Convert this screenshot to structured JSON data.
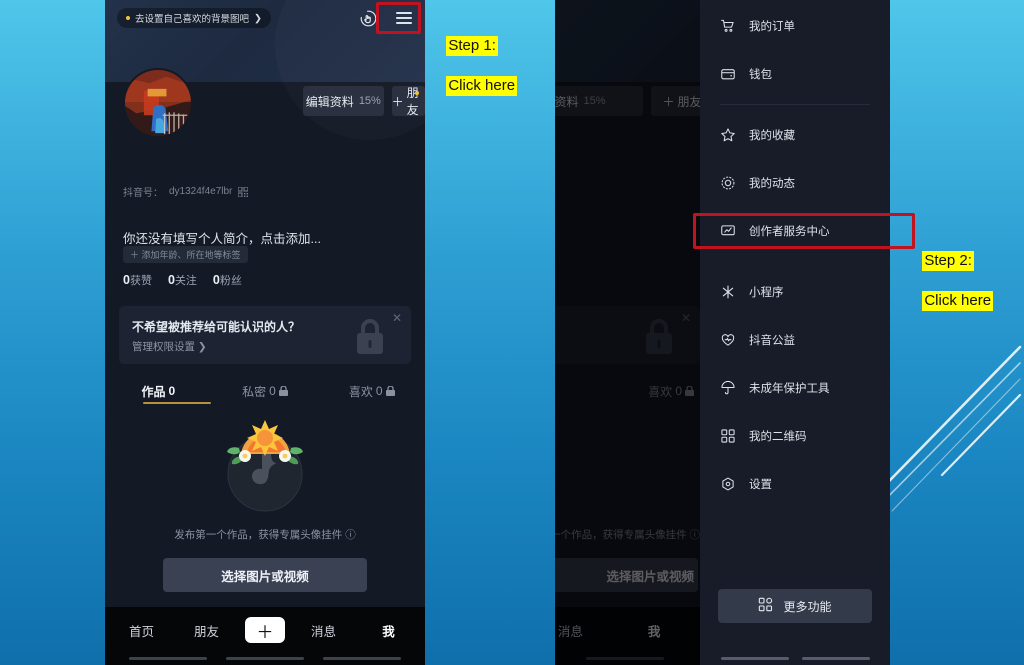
{
  "background": {
    "top_color": "#4fc6ea",
    "bottom_color": "#0f6fab"
  },
  "annotations": [
    {
      "id": "step1",
      "line1": "Step 1:",
      "line2": "Click here",
      "highlight_color": "#ffff00",
      "box_color": "#c1121f",
      "target": "hamburger-menu-button"
    },
    {
      "id": "step2",
      "line1": "Step 2:",
      "line2": "Click here",
      "highlight_color": "#ffff00",
      "box_color": "#c1121f",
      "target": "menu-item-creator-service-center"
    }
  ],
  "profile": {
    "cover_chip": "去设置自己喜欢的背景图吧",
    "cover_chip_arrow": "❯",
    "icons": {
      "pointer": "hand-pointer-icon",
      "menu": "hamburger-icon"
    },
    "edit_profile_label": "编辑资料",
    "edit_profile_percent": "15%",
    "add_friend_label": "朋友",
    "add_friend_plus": "＋",
    "douyin_id_label": "抖音号：",
    "douyin_id_value": "dy1324f4e7lbr",
    "bio_placeholder": "你还没有填写个人简介，点击添加...",
    "tag_button": "＋ 添加年龄、所在地等标签",
    "stats": [
      {
        "value": "0",
        "label": "获赞"
      },
      {
        "value": "0",
        "label": "关注"
      },
      {
        "value": "0",
        "label": "粉丝"
      }
    ],
    "privacy_banner": {
      "title": "不希望被推荐给可能认识的人？",
      "link": "管理权限设置",
      "link_arrow": "❯",
      "close": "✕"
    },
    "tabs": [
      {
        "label": "作品",
        "count": "0",
        "locked": false,
        "active": true
      },
      {
        "label": "私密",
        "count": "0",
        "locked": true,
        "active": false
      },
      {
        "label": "喜欢",
        "count": "0",
        "locked": true,
        "active": false
      }
    ],
    "empty_state_text": "发布第一个作品，获得专属头像挂件 ⓘ",
    "pick_button": "选择图片或视频",
    "tabbar": [
      {
        "label": "首页"
      },
      {
        "label": "朋友"
      },
      {
        "label": "＋"
      },
      {
        "label": "消息"
      },
      {
        "label": "我"
      }
    ]
  },
  "drawer": {
    "items": [
      {
        "icon": "cart-icon",
        "label": "我的订单"
      },
      {
        "icon": "wallet-icon",
        "label": "钱包"
      },
      {
        "icon": "star-icon",
        "label": "我的收藏"
      },
      {
        "icon": "activity-icon",
        "label": "我的动态"
      },
      {
        "icon": "monitor-icon",
        "label": "创作者服务中心",
        "highlighted": true
      },
      {
        "icon": "miniapp-icon",
        "label": "小程序"
      },
      {
        "icon": "heart-icon",
        "label": "抖音公益"
      },
      {
        "icon": "umbrella-icon",
        "label": "未成年保护工具"
      },
      {
        "icon": "qrcode-icon",
        "label": "我的二维码"
      },
      {
        "icon": "settings-icon",
        "label": "设置"
      }
    ],
    "more_button": {
      "icon": "grid-icon",
      "label": "更多功能"
    }
  }
}
